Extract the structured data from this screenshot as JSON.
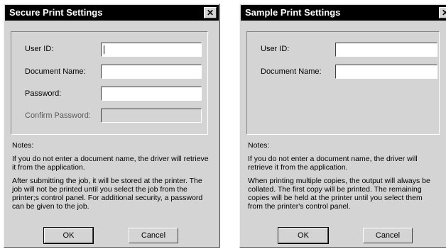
{
  "dialogs": [
    {
      "title": "Secure Print Settings",
      "close_glyph": "✕",
      "fields": [
        {
          "label": "User ID:",
          "value": ""
        },
        {
          "label": "Document Name:",
          "value": ""
        },
        {
          "label": "Password:",
          "value": ""
        },
        {
          "label": "Confirm Password:",
          "value": ""
        }
      ],
      "notes_heading": "Notes:",
      "notes": [
        "If you do not enter a document name, the driver will retrieve it from the application.",
        "After submitting the job, it will be stored at the printer. The job will not be printed until you select the job from the printer;s control panel. For additional security, a password can be given to the job."
      ],
      "ok_label": "OK",
      "cancel_label": "Cancel"
    },
    {
      "title": "Sample Print Settings",
      "close_glyph": "✕",
      "fields": [
        {
          "label": "User ID:",
          "value": ""
        },
        {
          "label": "Document Name:",
          "value": ""
        }
      ],
      "notes_heading": "Notes:",
      "notes": [
        "If you do not enter a document name, the driver will retrieve it from the application.",
        "When printing multiple copies, the output will always be collated. The first copy will be printed. The remaining copies will be held at the printer until you select them from the printer's control panel."
      ],
      "ok_label": "OK",
      "cancel_label": "Cancel"
    }
  ]
}
